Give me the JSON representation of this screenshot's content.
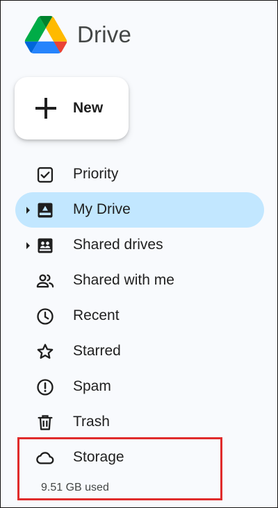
{
  "app": {
    "name": "Drive"
  },
  "new_button": {
    "label": "New"
  },
  "nav": {
    "items": [
      {
        "label": "Priority",
        "icon": "priority-icon"
      },
      {
        "label": "My Drive",
        "icon": "my-drive-icon",
        "active": true,
        "expandable": true
      },
      {
        "label": "Shared drives",
        "icon": "shared-drives-icon",
        "expandable": true
      },
      {
        "label": "Shared with me",
        "icon": "shared-with-me-icon"
      },
      {
        "label": "Recent",
        "icon": "clock-icon"
      },
      {
        "label": "Starred",
        "icon": "star-icon"
      },
      {
        "label": "Spam",
        "icon": "spam-icon"
      },
      {
        "label": "Trash",
        "icon": "trash-icon"
      },
      {
        "label": "Storage",
        "icon": "cloud-icon"
      }
    ]
  },
  "storage": {
    "used_text": "9.51 GB used"
  },
  "colors": {
    "active_bg": "#c2e7ff",
    "highlight_border": "#e02b2b",
    "sidebar_bg": "#f8fafd"
  }
}
